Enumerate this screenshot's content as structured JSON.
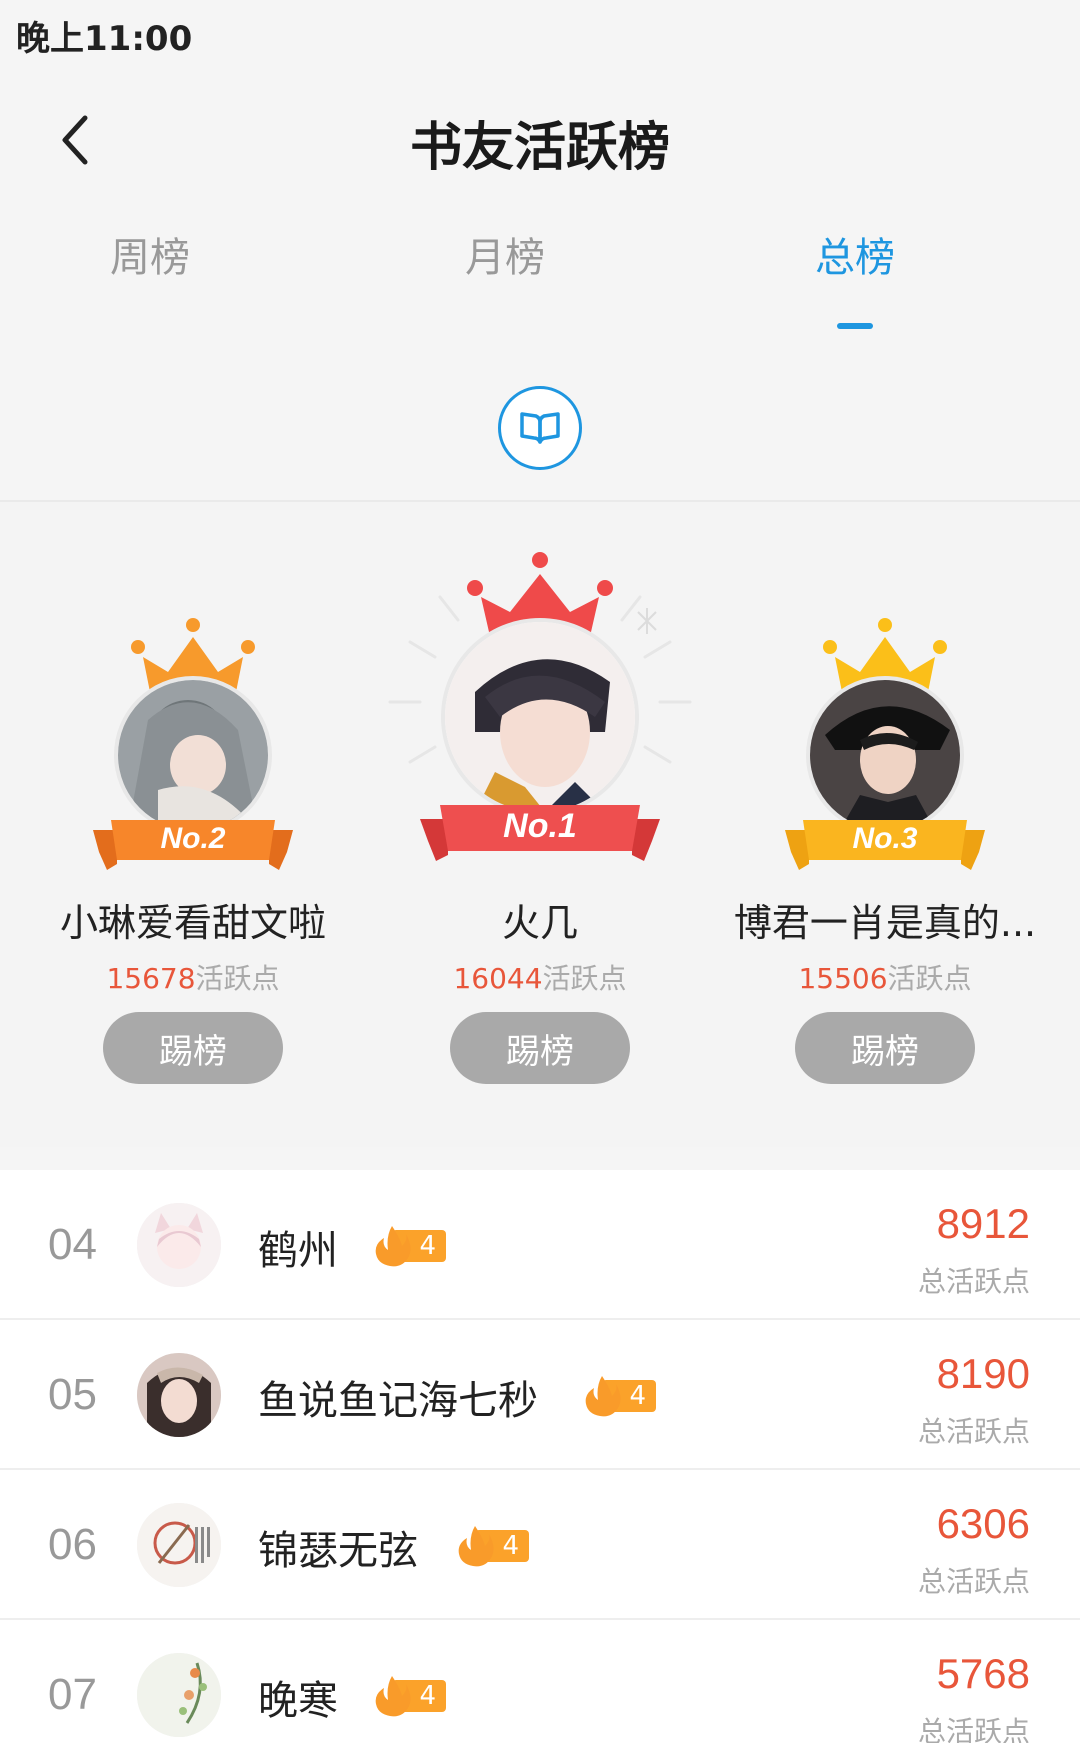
{
  "status": {
    "time": "晚上11:00"
  },
  "header": {
    "title": "书友活跃榜"
  },
  "tabs": [
    {
      "label": "周榜",
      "active": false
    },
    {
      "label": "月榜",
      "active": false
    },
    {
      "label": "总榜",
      "active": true
    }
  ],
  "podium": [
    {
      "rank_label": "No.2",
      "name": "小琳爱看甜文啦",
      "points": "15678",
      "points_unit": "活跃点",
      "button": "踢榜",
      "crown_color": "#f79a2c",
      "ribbon_color": "#f7862a"
    },
    {
      "rank_label": "No.1",
      "name": "火几",
      "points": "16044",
      "points_unit": "活跃点",
      "button": "踢榜",
      "crown_color": "#ef4a4a",
      "ribbon_color": "#ee4f4f"
    },
    {
      "rank_label": "No.3",
      "name": "博君一肖是真的...",
      "points": "15506",
      "points_unit": "活跃点",
      "button": "踢榜",
      "crown_color": "#fbbf19",
      "ribbon_color": "#fab51f"
    }
  ],
  "list": [
    {
      "rank": "04",
      "name": "鹤州",
      "level": "4",
      "score": "8912",
      "score_label": "总活跃点"
    },
    {
      "rank": "05",
      "name": "鱼说鱼记海七秒",
      "level": "4",
      "score": "8190",
      "score_label": "总活跃点"
    },
    {
      "rank": "06",
      "name": "锦瑟无弦",
      "level": "4",
      "score": "6306",
      "score_label": "总活跃点"
    },
    {
      "rank": "07",
      "name": "晚寒",
      "level": "4",
      "score": "5768",
      "score_label": "总活跃点"
    }
  ],
  "colors": {
    "accent": "#1e96e0",
    "score": "#e8563a",
    "badge": "#fba22a",
    "button_gray": "#a9a9a9"
  },
  "icons": {
    "back": "chevron-left-icon",
    "book": "open-book-icon",
    "level": "flame-icon"
  }
}
